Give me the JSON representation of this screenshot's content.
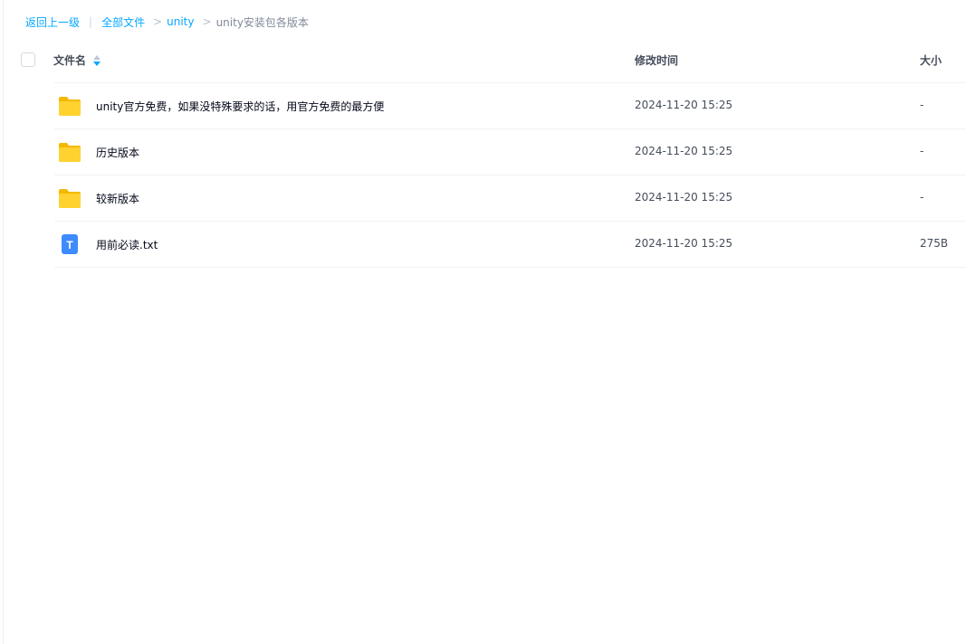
{
  "breadcrumb": {
    "back_label": "返回上一级",
    "divider": "|",
    "all_files_label": "全部文件",
    "separator": ">",
    "parent_label": "unity",
    "current_label": "unity安装包各版本"
  },
  "table": {
    "headers": {
      "name": "文件名",
      "time": "修改时间",
      "size": "大小"
    },
    "rows": [
      {
        "type": "folder-icon",
        "name": "unity官方免费，如果没特殊要求的话，用官方免费的最方便",
        "time": "2024-11-20 15:25",
        "size": "-"
      },
      {
        "type": "folder-icon",
        "name": "历史版本",
        "time": "2024-11-20 15:25",
        "size": "-"
      },
      {
        "type": "folder-icon",
        "name": "较新版本",
        "time": "2024-11-20 15:25",
        "size": "-"
      },
      {
        "type": "txt-file-icon",
        "name": "用前必读.txt",
        "time": "2024-11-20 15:25",
        "size": "275B",
        "icon_letter": "T"
      }
    ]
  },
  "colors": {
    "link": "#06a7ff",
    "folder": "#ffd230",
    "txt_icon": "#3e8bff"
  }
}
